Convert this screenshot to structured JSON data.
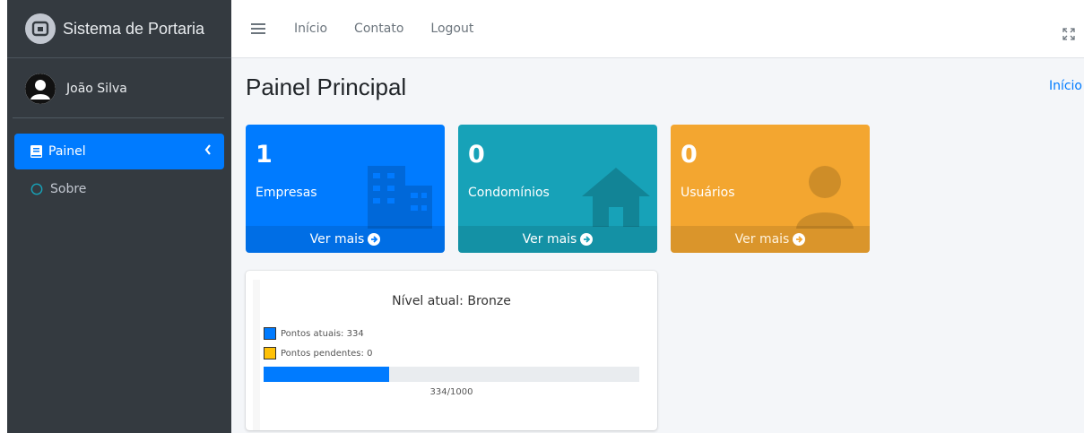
{
  "brand": {
    "name": "Sistema de Portaria"
  },
  "user": {
    "name": "João Silva"
  },
  "sidebar": {
    "items": [
      {
        "label": "Painel",
        "active": true,
        "icon": "book-icon"
      },
      {
        "label": "Sobre",
        "active": false,
        "icon": "circle-icon"
      }
    ]
  },
  "topbar": {
    "links": [
      "Início",
      "Contato",
      "Logout"
    ]
  },
  "page": {
    "title": "Painel Principal",
    "breadcrumb": "Início"
  },
  "cards": [
    {
      "count": "1",
      "label": "Empresas",
      "footer": "Ver mais",
      "color": "#007bff",
      "icon": "building-icon"
    },
    {
      "count": "0",
      "label": "Condomínios",
      "footer": "Ver mais",
      "color": "#17a2b8",
      "icon": "house-icon"
    },
    {
      "count": "0",
      "label": "Usuários",
      "footer": "Ver mais",
      "color": "#f3a630",
      "icon": "user-icon"
    }
  ],
  "level": {
    "title": "Nível atual: Bronze",
    "legend": [
      {
        "label": "Pontos atuais: 334",
        "color": "#007bff"
      },
      {
        "label": "Pontos pendentes: 0",
        "color": "#ffc107"
      }
    ],
    "progress_fraction": 0.334,
    "progress_text": "334/1000"
  }
}
